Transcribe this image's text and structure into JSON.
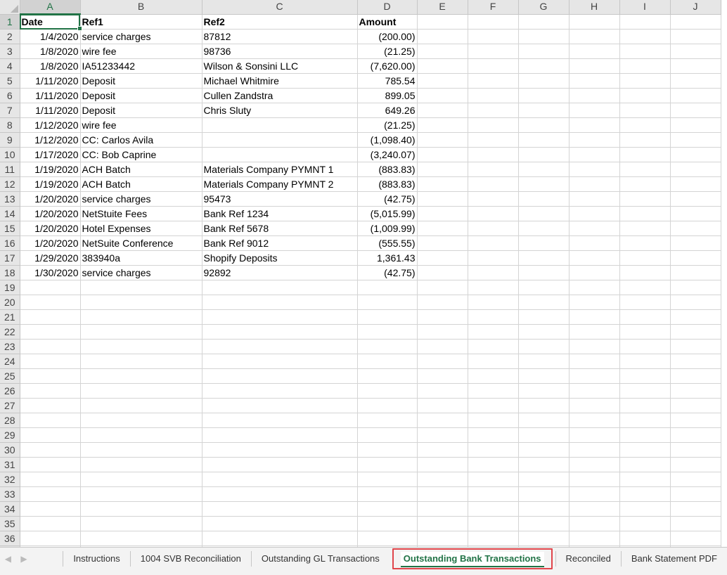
{
  "columns": [
    "A",
    "B",
    "C",
    "D",
    "E",
    "F",
    "G",
    "H",
    "I",
    "J"
  ],
  "header_row": {
    "date": "Date",
    "ref1": "Ref1",
    "ref2": "Ref2",
    "amount": "Amount"
  },
  "rows": [
    {
      "date": "1/4/2020",
      "ref1": "service charges",
      "ref2": "87812",
      "amount": "(200.00)"
    },
    {
      "date": "1/8/2020",
      "ref1": "wire fee",
      "ref2": "98736",
      "amount": "(21.25)"
    },
    {
      "date": "1/8/2020",
      "ref1": "IA51233442",
      "ref2": "Wilson & Sonsini LLC",
      "amount": "(7,620.00)"
    },
    {
      "date": "1/11/2020",
      "ref1": "Deposit",
      "ref2": "Michael Whitmire",
      "amount": "785.54"
    },
    {
      "date": "1/11/2020",
      "ref1": "Deposit",
      "ref2": "Cullen Zandstra",
      "amount": "899.05"
    },
    {
      "date": "1/11/2020",
      "ref1": "Deposit",
      "ref2": "Chris Sluty",
      "amount": "649.26"
    },
    {
      "date": "1/12/2020",
      "ref1": "wire fee",
      "ref2": "",
      "amount": "(21.25)"
    },
    {
      "date": "1/12/2020",
      "ref1": "CC: Carlos Avila",
      "ref2": "",
      "amount": "(1,098.40)"
    },
    {
      "date": "1/17/2020",
      "ref1": "CC: Bob Caprine",
      "ref2": "",
      "amount": "(3,240.07)"
    },
    {
      "date": "1/19/2020",
      "ref1": "ACH Batch",
      "ref2": "Materials Company PYMNT 1",
      "amount": "(883.83)"
    },
    {
      "date": "1/19/2020",
      "ref1": "ACH Batch",
      "ref2": "Materials Company PYMNT 2",
      "amount": "(883.83)"
    },
    {
      "date": "1/20/2020",
      "ref1": "service charges",
      "ref2": "95473",
      "amount": "(42.75)"
    },
    {
      "date": "1/20/2020",
      "ref1": "NetStuite Fees",
      "ref2": "Bank Ref 1234",
      "amount": "(5,015.99)"
    },
    {
      "date": "1/20/2020",
      "ref1": "Hotel Expenses",
      "ref2": "Bank Ref 5678",
      "amount": "(1,009.99)"
    },
    {
      "date": "1/20/2020",
      "ref1": "NetSuite Conference",
      "ref2": "Bank Ref 9012",
      "amount": "(555.55)"
    },
    {
      "date": "1/29/2020",
      "ref1": "383940a",
      "ref2": "Shopify Deposits",
      "amount": "1,361.43"
    },
    {
      "date": "1/30/2020",
      "ref1": "service charges",
      "ref2": "92892",
      "amount": "(42.75)"
    }
  ],
  "total_rows": 37,
  "tabs": [
    "Instructions",
    "1004 SVB Reconciliation",
    "Outstanding GL Transactions",
    "Outstanding Bank Transactions",
    "Reconciled",
    "Bank Statement PDF"
  ],
  "active_tab": "Outstanding Bank Transactions",
  "nav_icons": [
    "chevron-left-icon",
    "chevron-right-icon"
  ],
  "colors": {
    "accent": "#217346",
    "highlight": "#e0454b"
  }
}
